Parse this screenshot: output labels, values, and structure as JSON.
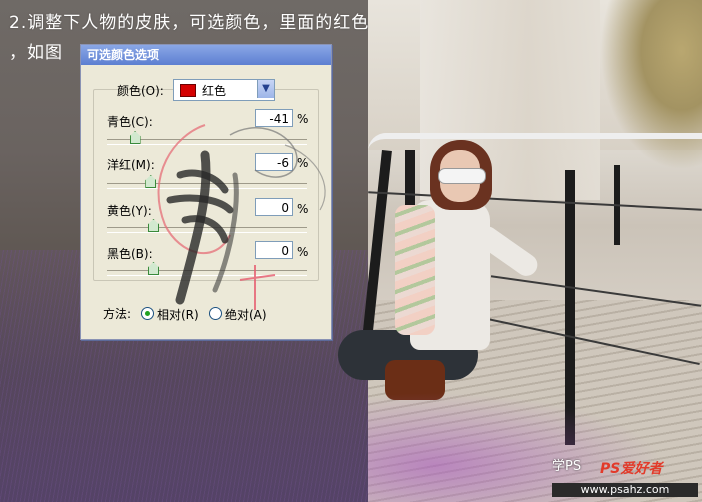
{
  "annotation": {
    "line1": "2.调整下人物的皮肤，可选颜色，里面的红色",
    "line2": "，如图"
  },
  "dialog": {
    "title": "可选颜色选项",
    "colors_label": "颜色(O):",
    "colors_value": "红色",
    "swatch_color": "#d40000",
    "sliders": [
      {
        "label": "青色(C):",
        "value": "-41",
        "unit": "%",
        "level": -41
      },
      {
        "label": "洋红(M):",
        "value": "-6",
        "unit": "%",
        "level": -6
      },
      {
        "label": "黄色(Y):",
        "value": "0",
        "unit": "%",
        "level": 0
      },
      {
        "label": "黑色(B):",
        "value": "0",
        "unit": "%",
        "level": 0
      }
    ],
    "method_label": "方法:",
    "method_options": [
      {
        "label": "相对(R)",
        "selected": true
      },
      {
        "label": "绝对(A)",
        "selected": false
      }
    ]
  },
  "logo": {
    "prefix": "学PS",
    "brand": "PS爱好者",
    "url": "www.psahz.com"
  }
}
